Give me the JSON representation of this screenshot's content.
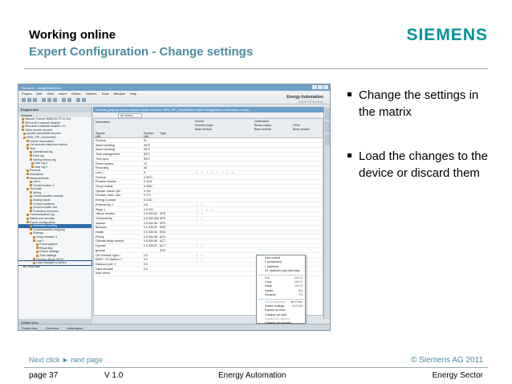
{
  "slide": {
    "title": "Working online",
    "subtitle": "Expert Configuration - Change settings",
    "brand": "SIEMENS"
  },
  "app": {
    "window_title": "Siemens  -  Using/StartDemo",
    "menu": [
      "Project",
      "Edit",
      "View",
      "Insert",
      "Online",
      "Options",
      "Tools",
      "Window",
      "Help"
    ],
    "brand_title": "Energy Automation",
    "brand_sub": "DIGSI 5 Premium",
    "project_tree_title": "Project tree",
    "devices_tab": "Devices",
    "breadcrumb": "Siemens_project  ▸  Online access  ▸  Online devices  ▸  NEW_SIP_Generic803  ▸  Expert configuration  ▸  Information routing",
    "filter_value": "All entries",
    "details_view": "Details view",
    "status_items": [
      "Portal view",
      "Overview",
      "Information"
    ],
    "tree_items": [
      {
        "label": "Manual: Fukum 4MDIGSI PC-6 Grp..."
      },
      {
        "label": "Microsoft Loopback Adapter"
      },
      {
        "label": "Microsoft Loopback Adapter <2>"
      },
      {
        "label": "Other remote devices"
      },
      {
        "label": "Update accessible devices"
      },
      {
        "label": "NEW_SIP_Generic803"
      },
      {
        "label": "Device information"
      },
      {
        "label": "Get process data from device"
      },
      {
        "label": "Test"
      },
      {
        "label": "Operational log"
      },
      {
        "label": "Fault log"
      },
      {
        "label": "Setting history log"
      },
      {
        "label": "User log 1"
      },
      {
        "label": "User log 2"
      },
      {
        "label": "Records"
      },
      {
        "label": "Indications"
      },
      {
        "label": "Measurements"
      },
      {
        "label": "Line 1"
      },
      {
        "label": "Circuit breaker 1"
      },
      {
        "label": "Test suite"
      },
      {
        "label": "Wiring"
      },
      {
        "label": "Communication module"
      },
      {
        "label": "Analog inputs"
      },
      {
        "label": "Control functions"
      },
      {
        "label": "Circuit-breaker test"
      },
      {
        "label": "Protection functions"
      },
      {
        "label": "Communication log"
      },
      {
        "label": "Safety and security"
      },
      {
        "label": "Expert configuration"
      },
      {
        "label": "Information routing"
      },
      {
        "label": "Communication mapping"
      },
      {
        "label": "Settings"
      },
      {
        "label": "Circuit breaker 1"
      },
      {
        "label": "Line 1"
      },
      {
        "label": "Power system"
      },
      {
        "label": "Recording"
      },
      {
        "label": "Device settings"
      },
      {
        "label": "Time settings"
      },
      {
        "label": "Function Block (GFC)"
      },
      {
        "label": "Load changes to device"
      },
      {
        "label": "Local data"
      }
    ],
    "matrix_header": {
      "information": "Information",
      "source": "Source",
      "destination": "Destination",
      "function_keys": "Function keys",
      "binary_output": "Binary output",
      "leds": "LEDs",
      "base_module_1": "Base module",
      "base_module_2": "Base module",
      "base_module_3": "Base module",
      "signals": "Signals",
      "number": "Number",
      "type": "Type",
      "all_1": "(All)",
      "all_2": "(All)"
    },
    "matrix_rows": [
      {
        "signal": "General",
        "number": "91",
        "type": ""
      },
      {
        "signal": "Alarm handling",
        "number": "4579",
        "type": ""
      },
      {
        "signal": "Alarm handling",
        "number": "9970",
        "type": ""
      },
      {
        "signal": "Time management",
        "number": "5971",
        "type": ""
      },
      {
        "signal": "Time sync.",
        "number": "5972",
        "type": ""
      },
      {
        "signal": "Power system",
        "number": "10",
        "type": ""
      },
      {
        "signal": "Recording",
        "number": "50",
        "type": ""
      },
      {
        "signal": "Line 1",
        "number": "8",
        "type": ""
      },
      {
        "signal": "General",
        "number": "0.0671",
        "type": ""
      },
      {
        "signal": "Process monitor",
        "number": "0.1101",
        "type": ""
      },
      {
        "signal": "Group indicat.",
        "number": "0.4551",
        "type": ""
      },
      {
        "signal": "Operati. values 3ph",
        "number": "0.761",
        "type": ""
      },
      {
        "signal": "Fundam. harm. 3ph",
        "number": "0.771",
        "type": ""
      },
      {
        "signal": "Energy 3-phase",
        "number": "0.1021",
        "type": ""
      },
      {
        "signal": "External trip 1",
        "number": "0.6",
        "type": ""
      },
      {
        "signal": "Stage 1",
        "number": "0.0.931",
        "type": ""
      },
      {
        "signal": "»Block function",
        "number": "0.0.930.82",
        "type": "SPS"
      },
      {
        "signal": "»External trip",
        "number": "0.0.930.500",
        "type": "SPS"
      },
      {
        "signal": "Inactive",
        "number": "0.0.930.58",
        "type": "SPS"
      },
      {
        "signal": "Behavior",
        "number": "0.0.930.52",
        "type": "ENS"
      },
      {
        "signal": "Health",
        "number": "0.0.930.53",
        "type": "ENS"
      },
      {
        "signal": "Pickup",
        "number": "0.0.930.55",
        "type": "ACD"
      },
      {
        "signal": "Operate delay expired",
        "number": "0.0.930.56",
        "type": "ACT"
      },
      {
        "signal": "Operate",
        "number": "0.0.930.57",
        "type": "ACT"
      },
      {
        "signal": "general",
        "number": "",
        "type": "SPS"
      },
      {
        "signal": "CB Overexit. light 1",
        "number": "0.0",
        "type": ""
      },
      {
        "signal": "SNRF / IO Options 1",
        "number": "0.0",
        "type": ""
      },
      {
        "signal": "Distance prot. 1",
        "number": "0.0",
        "type": ""
      },
      {
        "signal": "Fault recorder",
        "number": "0.0",
        "type": ""
      },
      {
        "signal": "Main menu",
        "number": "",
        "type": ""
      }
    ],
    "context_menu": [
      {
        "label": "(Not routed)",
        "shortcut": "",
        "dim": false
      },
      {
        "label": "L (unlatched)",
        "shortcut": "",
        "dim": false
      },
      {
        "label": "L (latched)",
        "shortcut": "",
        "dim": false
      },
      {
        "label": "NT (latched) only with relay",
        "shortcut": "",
        "dim": false
      },
      {
        "label": "Cut",
        "shortcut": "Ctrl+X",
        "dim": false
      },
      {
        "label": "Copy",
        "shortcut": "Ctrl+C",
        "dim": false
      },
      {
        "label": "Paste",
        "shortcut": "Ctrl+V",
        "dim": false
      },
      {
        "label": "Delete",
        "shortcut": "Del",
        "dim": false
      },
      {
        "label": "Rename",
        "shortcut": "F2",
        "dim": false
      },
      {
        "label": "Show properties",
        "shortcut": "Alt+Enter",
        "dim": true
      },
      {
        "label": "Delete routings",
        "shortcut": "Ctrl+Del",
        "dim": false
      },
      {
        "label": "Expand all rows",
        "shortcut": "",
        "dim": false
      },
      {
        "label": "Collapse all rows",
        "shortcut": "",
        "dim": false
      },
      {
        "label": "Expand all columns",
        "shortcut": "",
        "dim": true
      },
      {
        "label": "Collapse all columns",
        "shortcut": "",
        "dim": false
      }
    ]
  },
  "bullets": [
    "Change the settings in the matrix",
    "Load the changes to the device or discard them"
  ],
  "footer": {
    "next_click": "Next click ► next page",
    "copyright": "© Siemens AG 2011",
    "page": "page 37",
    "version": "V 1.0",
    "center": "Energy Automation",
    "right": "Energy Sector"
  },
  "colors": {
    "brand": "#00939a",
    "subtitle": "#4a8da0",
    "highlight": "#2e6aa8"
  }
}
